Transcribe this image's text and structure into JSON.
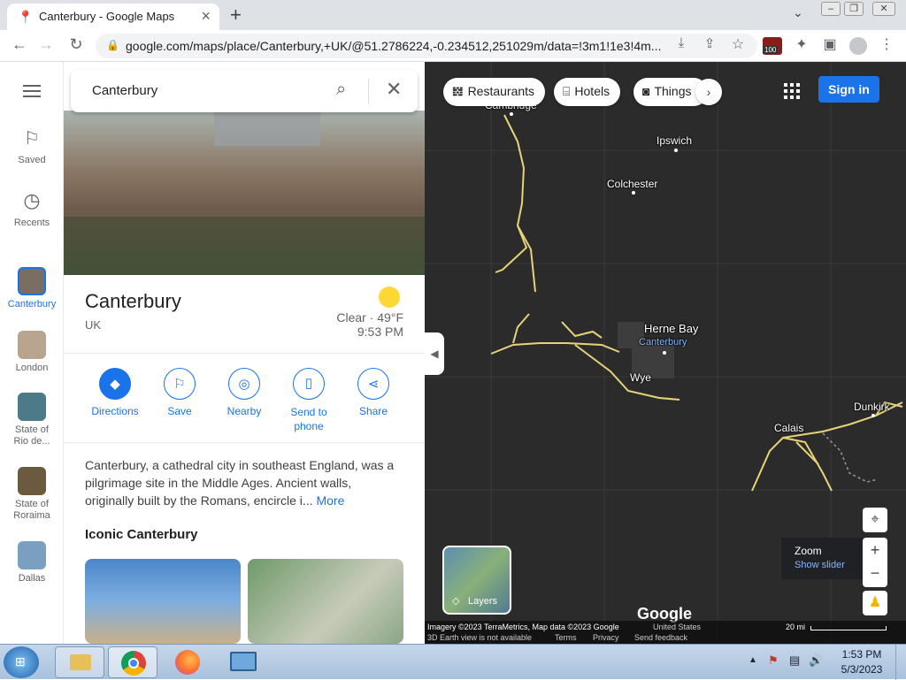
{
  "browser": {
    "tab_title": "Canterbury - Google Maps",
    "url": "google.com/maps/place/Canterbury,+UK/@51.2786224,-0.234512,251029m/data=!3m1!1e3!4m...",
    "ext_badge": "100"
  },
  "rail": {
    "menu_label": "",
    "saved": "Saved",
    "recents": "Recents",
    "places": [
      "Canterbury",
      "London",
      "State of Rio de...",
      "State of Roraima",
      "Dallas"
    ]
  },
  "search": {
    "value": "Canterbury"
  },
  "place": {
    "name": "Canterbury",
    "country": "UK",
    "weather": "Clear · 49°F",
    "time": "9:53 PM",
    "description": "Canterbury, a cathedral city in southeast England, was a pilgrimage site in the Middle Ages. Ancient walls, originally built by the Romans, encircle i...",
    "more": "More",
    "section_title": "Iconic Canterbury"
  },
  "actions": [
    {
      "label": "Directions"
    },
    {
      "label": "Save"
    },
    {
      "label": "Nearby"
    },
    {
      "label": "Send to phone"
    },
    {
      "label": "Share"
    }
  ],
  "chips": {
    "restaurants": "Restaurants",
    "hotels": "Hotels",
    "things": "Things"
  },
  "header": {
    "signin": "Sign in"
  },
  "map": {
    "labels": {
      "cambridge": "Cambridge",
      "ipswich": "Ipswich",
      "colchester": "Colchester",
      "herne_bay": "Herne Bay",
      "canterbury": "Canterbury",
      "wye": "Wye",
      "calais": "Calais",
      "dunkirk": "Dunkirk"
    },
    "layers": "Layers",
    "zoom_title": "Zoom",
    "zoom_slider": "Show slider",
    "logo": "Google",
    "attribution": "Imagery ©2023 TerraMetrics, Map data ©2023 Google",
    "region": "United States",
    "earth": "3D Earth view is not available",
    "terms": "Terms",
    "privacy": "Privacy",
    "feedback": "Send feedback",
    "scale": "20 mi"
  },
  "taskbar": {
    "time": "1:53 PM",
    "date": "5/3/2023"
  },
  "colors": {
    "accent": "#1a73e8",
    "road": "#e8d27a"
  }
}
